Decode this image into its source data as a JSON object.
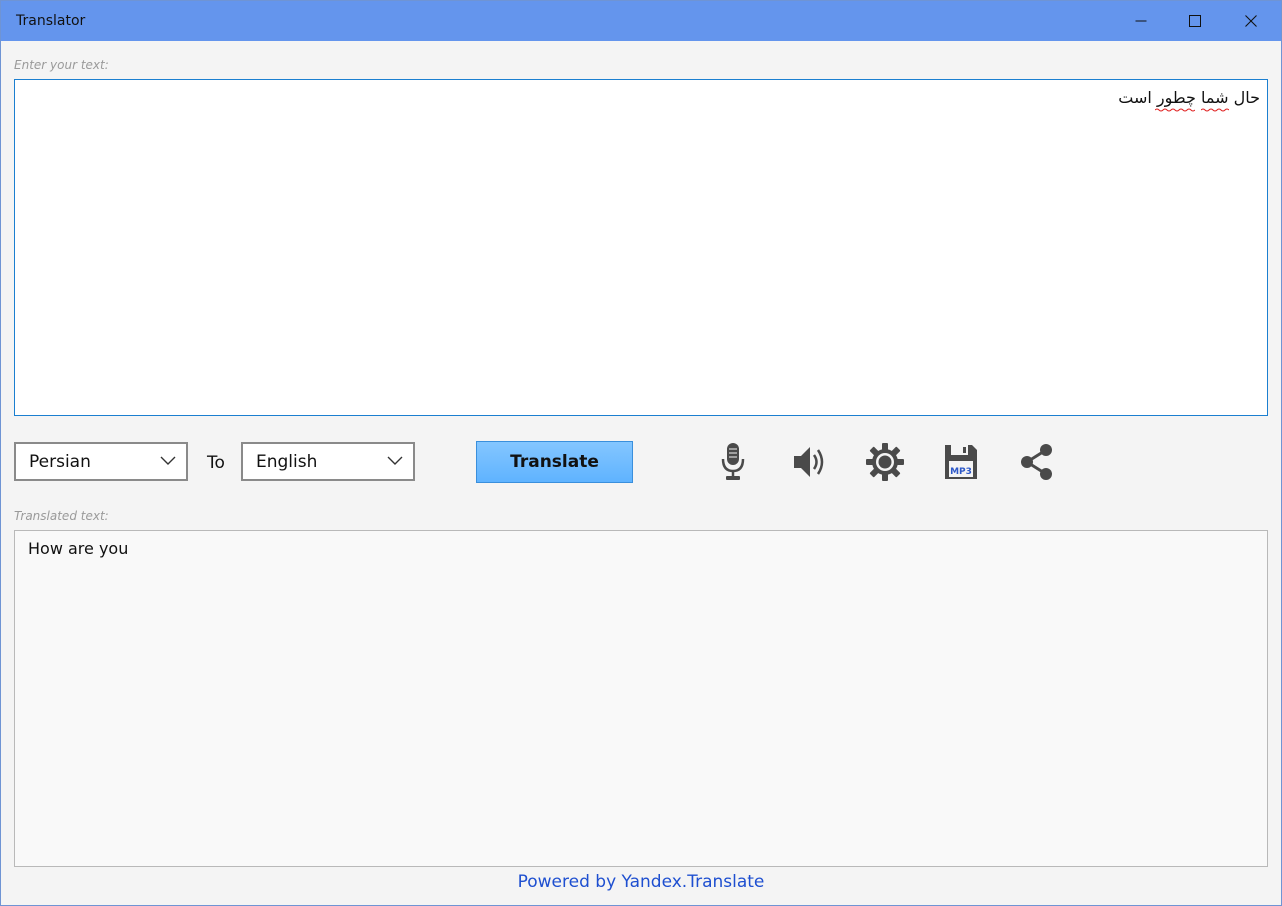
{
  "window": {
    "title": "Translator",
    "controls": [
      "minimize-icon",
      "maximize-icon",
      "close-icon"
    ]
  },
  "input": {
    "label": "Enter your text:",
    "value": "حال شما چطور است"
  },
  "controls": {
    "source_language": "Persian",
    "to_label": "To",
    "target_language": "English",
    "translate_label": "Translate",
    "tools": [
      "microphone-icon",
      "speaker-icon",
      "settings-gear-icon",
      "save-mp3-icon",
      "share-icon"
    ],
    "save_icon_text": "MP3"
  },
  "output": {
    "label": "Translated text:",
    "value": "How are you"
  },
  "footer": {
    "link_text": "Powered by Yandex.Translate"
  },
  "colors": {
    "titlebar": "#6495ed",
    "accent": "#1b7fd0",
    "button": "#5fb3ff",
    "link": "#1e4fd0",
    "icon": "#4a4a4a"
  }
}
